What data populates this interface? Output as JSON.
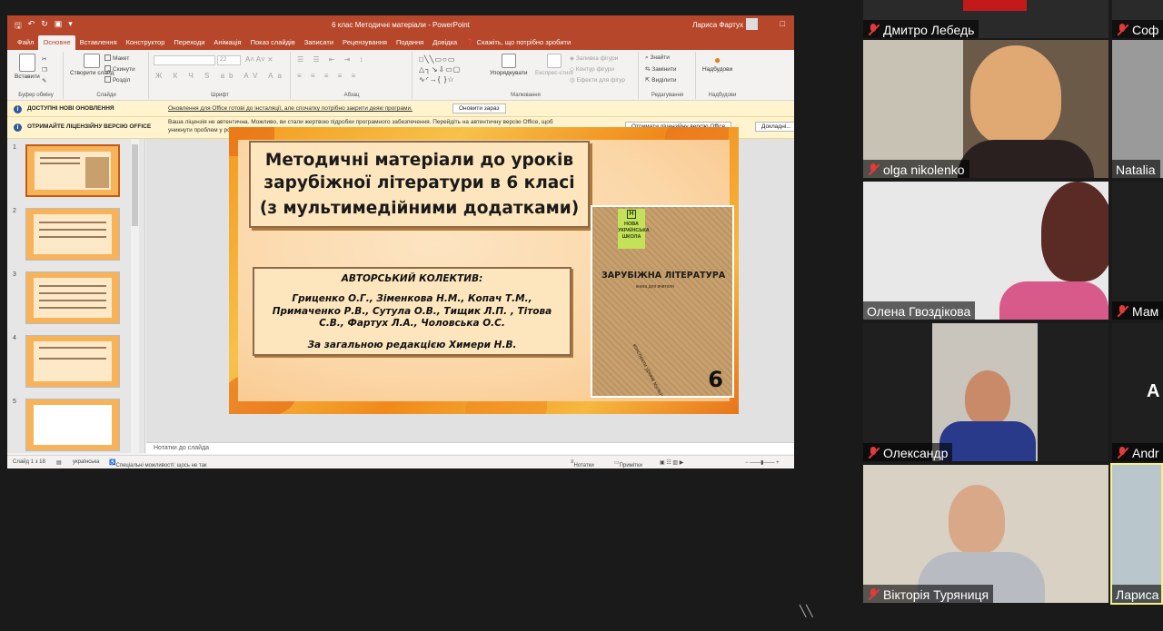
{
  "ppt": {
    "window_title": "6 клас Методичні матеріали  -  PowerPoint",
    "user_name": "Лариса Фартух",
    "tabs": [
      "Файл",
      "Основне",
      "Вставлення",
      "Конструктор",
      "Переходи",
      "Анімація",
      "Показ слайдів",
      "Записати",
      "Рецензування",
      "Подання",
      "Довідка"
    ],
    "active_tab": "Основне",
    "tell_me": "Скажіть, що потрібно зробити",
    "ribbon": {
      "paste": "Вставити",
      "clipboard": "Буфер обміну",
      "new_slide": "Створити слайд",
      "layout": "Макет",
      "reset": "Скинути",
      "section": "Розділ",
      "slides": "Слайди",
      "font": "Шрифт",
      "font_size": "22",
      "paragraph": "Абзац",
      "arrange": "Упорядкувати",
      "quick_styles": "Експрес-стилі",
      "fill": "Заливка фігури",
      "outline": "Контур фігури",
      "effects": "Ефекти для фігур",
      "drawing": "Малювання",
      "find": "Знайти",
      "replace": "Замінити",
      "select": "Виділити",
      "editing": "Редагування",
      "sensitivity": "Надбудови",
      "addins": "Надбудови"
    },
    "msg_update": {
      "title": "ДОСТУПНІ НОВІ ОНОВЛЕННЯ",
      "text": "Оновлення для Office готові до інсталяції, але спочатку потрібно закрити деякі програми.",
      "button": "Оновити зараз"
    },
    "msg_license": {
      "title": "ОТРИМАЙТЕ ЛІЦЕНЗІЙНУ ВЕРСІЮ OFFICE",
      "text1": "Ваша ліцензія не автентична. Можливо, ви стали жертвою підробки програмного забезпечення. Перейдіть на автентичну версію Office, щоб",
      "text2": "уникнути проблем у роботі та зберегти файли в безпеці.",
      "button1": "Отримати ліцензійну версію Office",
      "button2": "Докладні..."
    },
    "thumbs": [
      "1",
      "2",
      "3",
      "4",
      "5"
    ],
    "notes_placeholder": "Нотатки до слайда",
    "status": {
      "slide": "Слайд 1 з 18",
      "language": "українська",
      "accessibility": "Спеціальні можливості: щось не так",
      "notes": "Нотатки",
      "comments": "Примітки"
    }
  },
  "slide": {
    "title_l1": "Методичні матеріали до уроків",
    "title_l2": "зарубіжної літератури в 6 класі",
    "title_l3": "(з мультимедійними додатками)",
    "authors_heading": "АВТОРСЬКИЙ КОЛЕКТИВ:",
    "authors": "Гриценко О.Г., Зіменкова Н.М., Копач Т.М., Примаченко Р.В., Сутула О.В., Тищик Л.П. , Тітова С.В., Фартух Л.А., Чоловська О.С.",
    "editor": "За загальною редакцією  Химери Н.В.",
    "book": {
      "badge": "НОВА УКРАЇНСЬКА ШКОЛА",
      "badge_letter": "Н",
      "title": "ЗАРУБІЖНА ЛІТЕРАТУРА",
      "subtitle": "книга для вчителя",
      "spine": "конспекти уроків  мультимедійні додатки",
      "grade": "6"
    }
  },
  "participants": [
    {
      "name": "Дмитро Лебедь",
      "muted": true
    },
    {
      "name": "Соф",
      "muted": true
    },
    {
      "name": "olga nikolenko",
      "muted": true
    },
    {
      "name": "Natalia",
      "muted": false
    },
    {
      "name": "Олена Гвоздікова",
      "muted": false
    },
    {
      "name": "Мам",
      "muted": true
    },
    {
      "name": "Олександр",
      "muted": true
    },
    {
      "name": "Andr",
      "muted": true
    },
    {
      "name": "Вікторія Туряниця",
      "muted": true
    },
    {
      "name": "Лариса",
      "muted": false
    }
  ],
  "avatar_initial": "A",
  "colors": {
    "ppt_accent": "#b7472a",
    "muted_mic": "#e23a3a",
    "active_speaker_border": "#f4f08a"
  }
}
